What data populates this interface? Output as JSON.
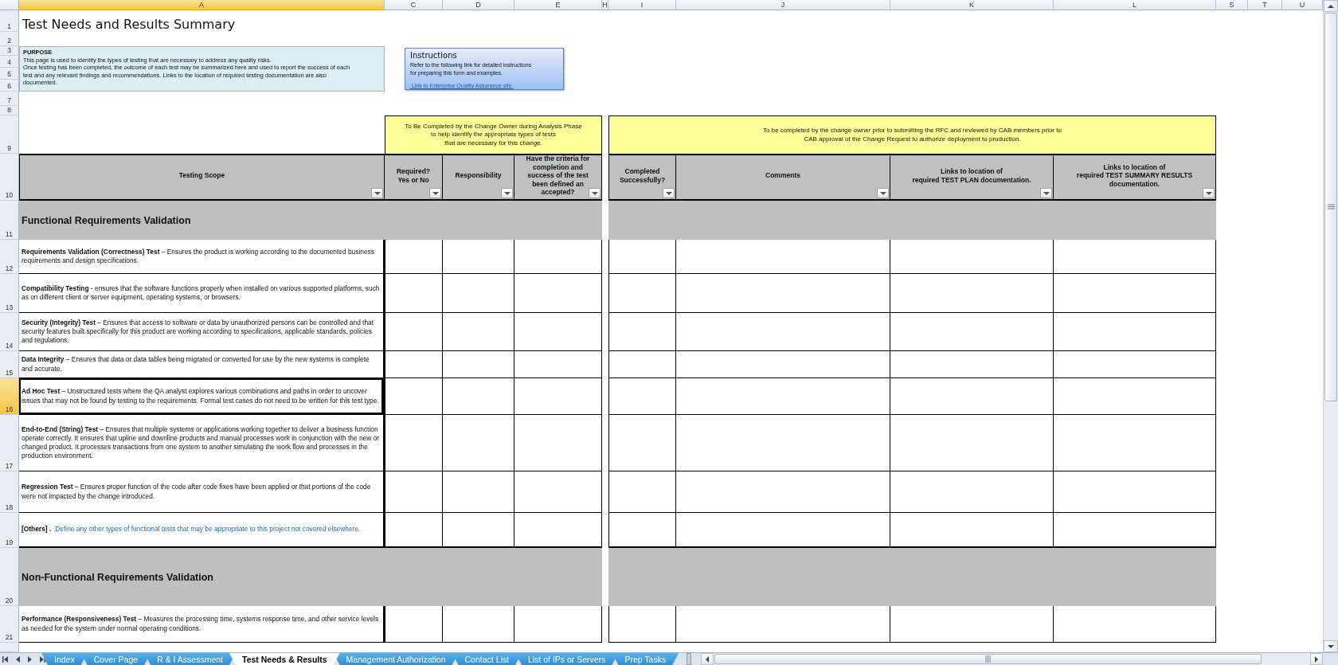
{
  "column_headers": [
    {
      "label": "A",
      "selected": true
    },
    {
      "label": "C",
      "selected": false
    },
    {
      "label": "D",
      "selected": false
    },
    {
      "label": "E",
      "selected": false
    },
    {
      "label": "H",
      "selected": false
    },
    {
      "label": "I",
      "selected": false
    },
    {
      "label": "J",
      "selected": false
    },
    {
      "label": "K",
      "selected": false
    },
    {
      "label": "L",
      "selected": false
    },
    {
      "label": "S",
      "selected": false
    },
    {
      "label": "T",
      "selected": false
    },
    {
      "label": "U",
      "selected": false
    }
  ],
  "row_numbers": [
    {
      "label": "1",
      "selected": false
    },
    {
      "label": "2",
      "selected": false
    },
    {
      "label": "3",
      "selected": false
    },
    {
      "label": "4",
      "selected": false
    },
    {
      "label": "5",
      "selected": false
    },
    {
      "label": "6",
      "selected": false
    },
    {
      "label": "7",
      "selected": false
    },
    {
      "label": "8",
      "selected": false
    },
    {
      "label": "9",
      "selected": false
    },
    {
      "label": "10",
      "selected": false
    },
    {
      "label": "11",
      "selected": false
    },
    {
      "label": "12",
      "selected": false
    },
    {
      "label": "13",
      "selected": false
    },
    {
      "label": "14",
      "selected": false
    },
    {
      "label": "15",
      "selected": false
    },
    {
      "label": "16",
      "selected": true
    },
    {
      "label": "17",
      "selected": false
    },
    {
      "label": "18",
      "selected": false
    },
    {
      "label": "19",
      "selected": false
    },
    {
      "label": "20",
      "selected": false
    },
    {
      "label": "21",
      "selected": false
    }
  ],
  "title": "Test Needs and Results Summary",
  "purpose": {
    "heading": "PURPOSE",
    "text": " This page is used to identify the types of testing that are necessary to address any quality risks.\nOnce testing has been completed, the outcome of each test may be summarized here and used to report the success of each\ntest and any relevant findings and recommendations. Links to the location of required testing documentation are also\ndocumented."
  },
  "instructions": {
    "title": "Instructions",
    "text": "Refer to the following  link for detailed instructions\nfor preparing this form and examples.",
    "link": " Link to Enterprise Quality Assurance site."
  },
  "phase_notes": [
    "To Be Completed by the Change Owner during Analysis Phase\nto help identify the appropriate types of tests\nthat are necessary for this change.",
    "To be completed by the change owner prior to submitting the RFC and reviewed by CAB members prior to\nCAB approval of the Change Request  to authorize deployment to production."
  ],
  "columns": [
    {
      "label": "Testing Scope"
    },
    {
      "label": "Required?\nYes or No"
    },
    {
      "label": "Responsibility"
    },
    {
      "label": "Have the criteria for\ncompletion and\nsuccess of the test\nbeen defined an\naccepted?"
    },
    {
      "label": "Completed\nSuccessfully?"
    },
    {
      "label": "Comments"
    },
    {
      "label": "Links to location of\nrequired TEST PLAN documentation."
    },
    {
      "label": "Links to location of\nrequired TEST SUMMARY RESULTS\ndocumentation."
    }
  ],
  "sections": [
    {
      "title": "Functional Requirements Validation",
      "rows": [
        {
          "kind": "test",
          "selected": false,
          "text": "**Requirements Validation (Correctness) Test** – Ensures the product is working according to the documented business requirements and design specifications."
        },
        {
          "kind": "test",
          "selected": false,
          "text": "**Compatibility Testing**  - ensures that the software functions properly when installed on various supported platforms, such as on different client or server equipment, operating systems, or browsers."
        },
        {
          "kind": "test",
          "selected": false,
          "text": "**Security (Integrity) Test** –  Ensures that access to software or data by unauthorized persons can be controlled and that security features built specifically for this product are working according to specifications, applicable standards, policies and regulations."
        },
        {
          "kind": "test",
          "selected": false,
          "text": "**Data Integrity** –  Ensures that data or data tables being migrated or converted for use by the new systems is complete and accurate."
        },
        {
          "kind": "test",
          "selected": true,
          "text": "**Ad Hoc Test** –  Unstructured tests where the QA analyst explores various combinations and paths in order to uncover issues that may not be found by testing to the requirements.  Formal test cases do not need to be written for this test type."
        },
        {
          "kind": "test",
          "selected": false,
          "text": "**End-to-End (String) Test** –  Ensures that multiple systems or applications working together to deliver a business function operate correctly.  It ensures that upline and downline products and manual processes work in conjunction with the new or changed product.  It processes transactions from one system to another simulating the work flow and processes in the production environment."
        },
        {
          "kind": "test",
          "selected": false,
          "text": "**Regression Test** –  Ensures proper function of the code after code fixes have been applied or that portions of the code were not impacted by the change introduced."
        },
        {
          "kind": "note",
          "selected": false,
          "label": "[Others] .",
          "hint": "Define any other types of functional tests that may be appropriate to this project not covered elsewhere."
        }
      ]
    },
    {
      "title": "Non-Functional Requirements Validation",
      "rows": [
        {
          "kind": "test",
          "selected": false,
          "text": "**Performance (Responsiveness) Test** –  Measures the processing time, systems response time,  and other service levels as needed for the system under normal operating conditions."
        }
      ]
    }
  ],
  "sheet_tabs": [
    {
      "label": "Index",
      "selected": false
    },
    {
      "label": "Cover Page",
      "selected": false
    },
    {
      "label": "R & I Assessment",
      "selected": false
    },
    {
      "label": "Test Needs & Results",
      "selected": true
    },
    {
      "label": "Management Authorization",
      "selected": false
    },
    {
      "label": "Contact List",
      "selected": false
    },
    {
      "label": "List of IPs or Servers",
      "selected": false
    },
    {
      "label": "Prep Tasks",
      "selected": false
    }
  ]
}
